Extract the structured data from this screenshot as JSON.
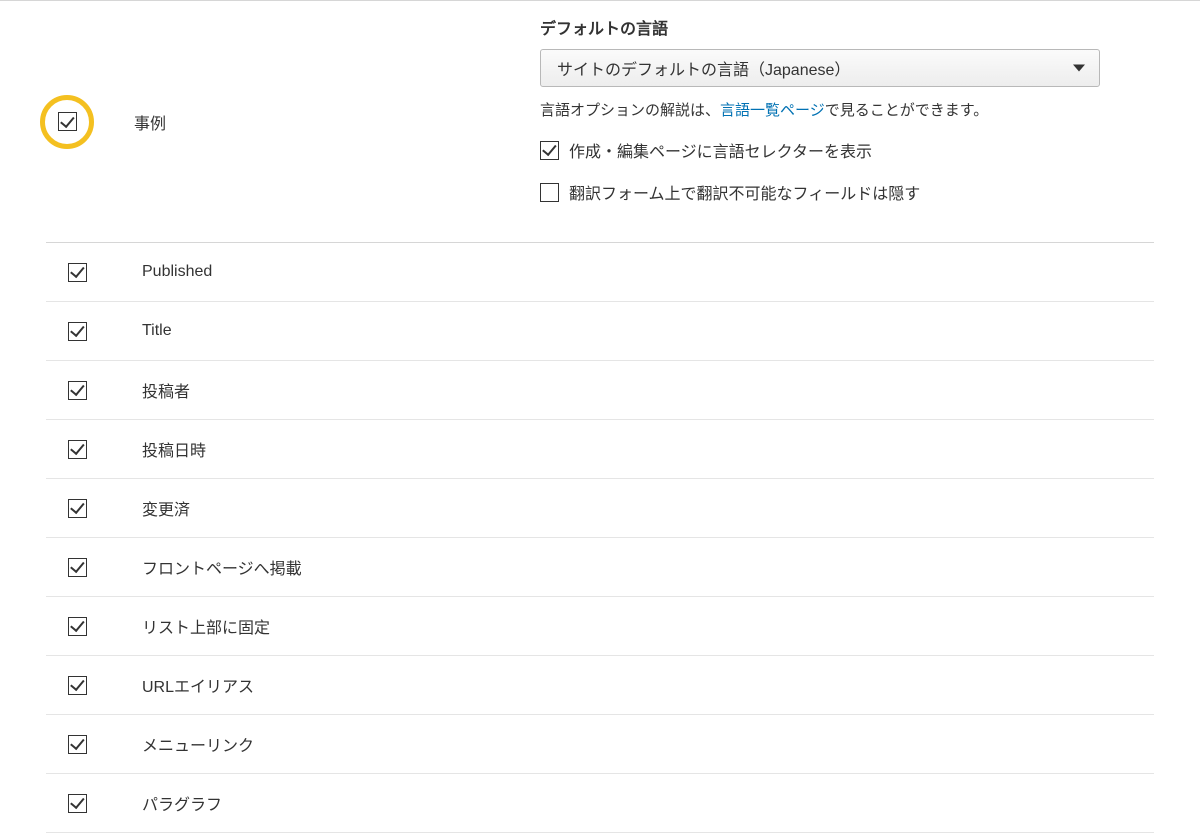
{
  "top": {
    "jirei_label": "事例",
    "jirei_checked": true
  },
  "language": {
    "section_label": "デフォルトの言語",
    "select_value": "サイトのデフォルトの言語（Japanese）",
    "help_prefix": "言語オプションの解説は、",
    "help_link": "言語一覧ページ",
    "help_suffix": "で見ることができます。",
    "show_selector": {
      "label": "作成・編集ページに言語セレクターを表示",
      "checked": true
    },
    "hide_untranslatable": {
      "label": "翻訳フォーム上で翻訳不可能なフィールドは隠す",
      "checked": false
    }
  },
  "fields": [
    {
      "label": "Published",
      "checked": true
    },
    {
      "label": "Title",
      "checked": true
    },
    {
      "label": "投稿者",
      "checked": true
    },
    {
      "label": "投稿日時",
      "checked": true
    },
    {
      "label": "変更済",
      "checked": true
    },
    {
      "label": "フロントページへ掲載",
      "checked": true
    },
    {
      "label": "リスト上部に固定",
      "checked": true
    },
    {
      "label": "URLエイリアス",
      "checked": true
    },
    {
      "label": "メニューリンク",
      "checked": true
    },
    {
      "label": "パラグラフ",
      "checked": true
    }
  ]
}
